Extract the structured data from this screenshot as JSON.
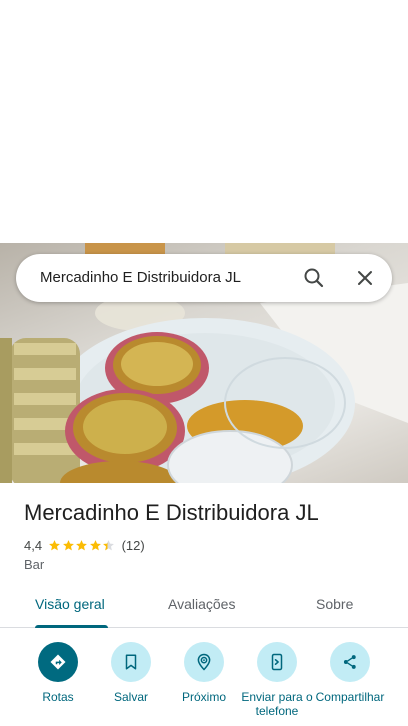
{
  "search": {
    "query": "Mercadinho E Distribuidora JL"
  },
  "place": {
    "name": "Mercadinho E Distribuidora JL",
    "rating": "4,4",
    "rating_stars": 4.4,
    "reviews_count": "(12)",
    "category": "Bar"
  },
  "photo": {
    "subject": "food-photo"
  },
  "tabs": [
    {
      "label": "Visão geral",
      "active": true
    },
    {
      "label": "Avaliações",
      "active": false
    },
    {
      "label": "Sobre",
      "active": false
    }
  ],
  "actions": [
    {
      "label": "Rotas",
      "icon": "directions-icon"
    },
    {
      "label": "Salvar",
      "icon": "bookmark-icon"
    },
    {
      "label": "Próximo",
      "icon": "nearby-icon"
    },
    {
      "label": "Enviar para o telefone",
      "icon": "send-to-phone-icon"
    },
    {
      "label": "Compartilhar",
      "icon": "share-icon"
    }
  ],
  "colors": {
    "accent": "#00677d",
    "accent_bg": "#c2ecf5",
    "primary_button": "#006a80",
    "star": "#fbbc04"
  }
}
